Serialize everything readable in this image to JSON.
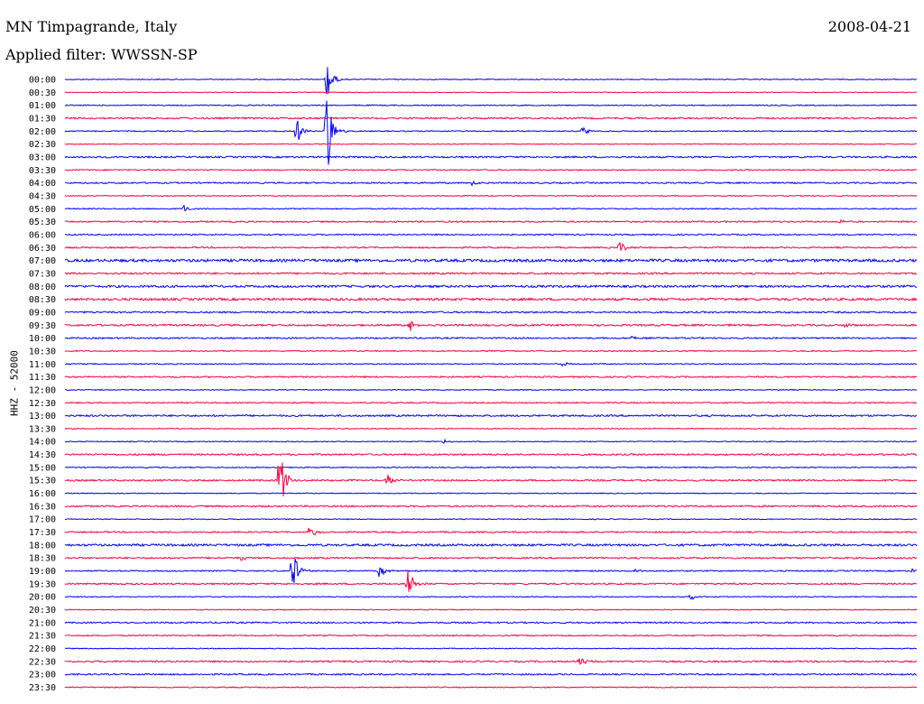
{
  "header": {
    "station": "MN Timpagrande, Italy",
    "date": "2008-04-21",
    "filter": "Applied filter: WWSSN-SP"
  },
  "chart_data": {
    "type": "line",
    "title": "MN Timpagrande, Italy",
    "ylabel": "HHZ - 52000",
    "colors": {
      "even_row": "#0000ff",
      "odd_row": "#ff0040"
    },
    "rows": [
      "00:00",
      "00:30",
      "01:00",
      "01:30",
      "02:00",
      "02:30",
      "03:00",
      "03:30",
      "04:00",
      "04:30",
      "05:00",
      "05:30",
      "06:00",
      "06:30",
      "07:00",
      "07:30",
      "08:00",
      "08:30",
      "09:00",
      "09:30",
      "10:00",
      "10:30",
      "11:00",
      "11:30",
      "12:00",
      "12:30",
      "13:00",
      "13:30",
      "14:00",
      "14:30",
      "15:00",
      "15:30",
      "16:00",
      "16:30",
      "17:00",
      "17:30",
      "18:00",
      "18:30",
      "19:00",
      "19:30",
      "20:00",
      "20:30",
      "21:00",
      "21:30",
      "22:00",
      "22:30",
      "23:00",
      "23:30"
    ],
    "noise": [
      0.5,
      0.4,
      0.6,
      0.9,
      0.6,
      0.5,
      0.9,
      0.7,
      0.8,
      0.5,
      0.6,
      0.8,
      0.7,
      0.8,
      1.5,
      1.0,
      1.2,
      1.3,
      0.9,
      1.0,
      0.8,
      0.6,
      0.6,
      0.8,
      0.5,
      0.7,
      1.0,
      0.5,
      0.5,
      0.9,
      0.6,
      0.9,
      0.5,
      0.9,
      0.5,
      0.8,
      1.2,
      0.9,
      0.7,
      0.9,
      0.5,
      0.5,
      0.8,
      0.7,
      0.5,
      0.9,
      0.8,
      0.6
    ],
    "events": [
      {
        "row": 0,
        "t": 0.307,
        "amp": 28
      },
      {
        "row": 4,
        "t": 0.272,
        "amp": 16
      },
      {
        "row": 4,
        "t": 0.307,
        "amp": 58
      },
      {
        "row": 4,
        "t": 0.606,
        "amp": 10
      },
      {
        "row": 8,
        "t": 0.477,
        "amp": 7
      },
      {
        "row": 10,
        "t": 0.139,
        "amp": 6
      },
      {
        "row": 11,
        "t": 0.91,
        "amp": 4
      },
      {
        "row": 13,
        "t": 0.651,
        "amp": 9
      },
      {
        "row": 19,
        "t": 0.404,
        "amp": 10
      },
      {
        "row": 19,
        "t": 0.915,
        "amp": 3
      },
      {
        "row": 20,
        "t": 0.665,
        "amp": 3
      },
      {
        "row": 22,
        "t": 0.583,
        "amp": 3
      },
      {
        "row": 28,
        "t": 0.444,
        "amp": 4
      },
      {
        "row": 31,
        "t": 0.252,
        "amp": 42
      },
      {
        "row": 31,
        "t": 0.378,
        "amp": 8
      },
      {
        "row": 35,
        "t": 0.288,
        "amp": 10
      },
      {
        "row": 37,
        "t": 0.205,
        "amp": 4
      },
      {
        "row": 38,
        "t": 0.266,
        "amp": 36
      },
      {
        "row": 38,
        "t": 0.368,
        "amp": 9
      },
      {
        "row": 38,
        "t": 0.669,
        "amp": 4
      },
      {
        "row": 38,
        "t": 0.993,
        "amp": 3
      },
      {
        "row": 39,
        "t": 0.402,
        "amp": 25
      },
      {
        "row": 40,
        "t": 0.735,
        "amp": 4
      },
      {
        "row": 45,
        "t": 0.603,
        "amp": 10
      }
    ]
  }
}
